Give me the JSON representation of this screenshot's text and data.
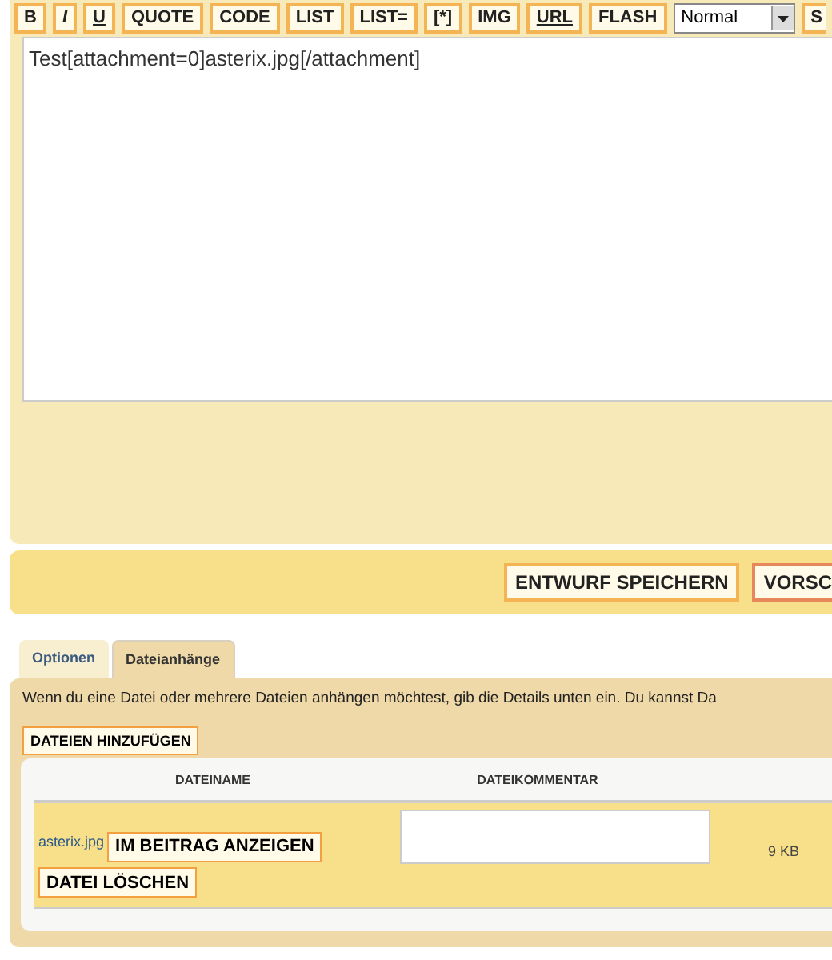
{
  "toolbar": {
    "buttons": [
      {
        "label": "B",
        "kind": "plain"
      },
      {
        "label": "I",
        "kind": "italic"
      },
      {
        "label": "U",
        "kind": "underline"
      },
      {
        "label": "QUOTE",
        "kind": "plain"
      },
      {
        "label": "CODE",
        "kind": "plain"
      },
      {
        "label": "LIST",
        "kind": "plain"
      },
      {
        "label": "LIST=",
        "kind": "plain"
      },
      {
        "label": "[*]",
        "kind": "plain"
      },
      {
        "label": "IMG",
        "kind": "plain"
      },
      {
        "label": "URL",
        "kind": "underline"
      },
      {
        "label": "FLASH",
        "kind": "plain"
      }
    ],
    "font_size_select": {
      "value": "Normal"
    },
    "cut_button": "S"
  },
  "editor": {
    "value": "Test[attachment=0]asterix.jpg[/attachment]"
  },
  "actions": {
    "buttons": [
      {
        "label": "ENTWURF SPEICHERN",
        "kind": "normal"
      },
      {
        "label": "VORSC",
        "kind": "cut"
      }
    ]
  },
  "tabs": [
    {
      "label": "Optionen",
      "selected": false
    },
    {
      "label": "Dateianhänge",
      "selected": true
    }
  ],
  "attachments": {
    "intro": "Wenn du eine Datei oder mehrere Dateien anhängen möchtest, gib die Details unten ein. Du kannst Da",
    "add_button": "DATEIEN HINZUFÜGEN",
    "columns": [
      "DATEINAME",
      "DATEIKOMMENTAR"
    ],
    "rows": [
      {
        "filename": "asterix.jpg",
        "show_button": "IM BEITRAG ANZEIGEN",
        "delete_button": "DATEI LÖSCHEN",
        "size": "9 KB"
      }
    ]
  }
}
